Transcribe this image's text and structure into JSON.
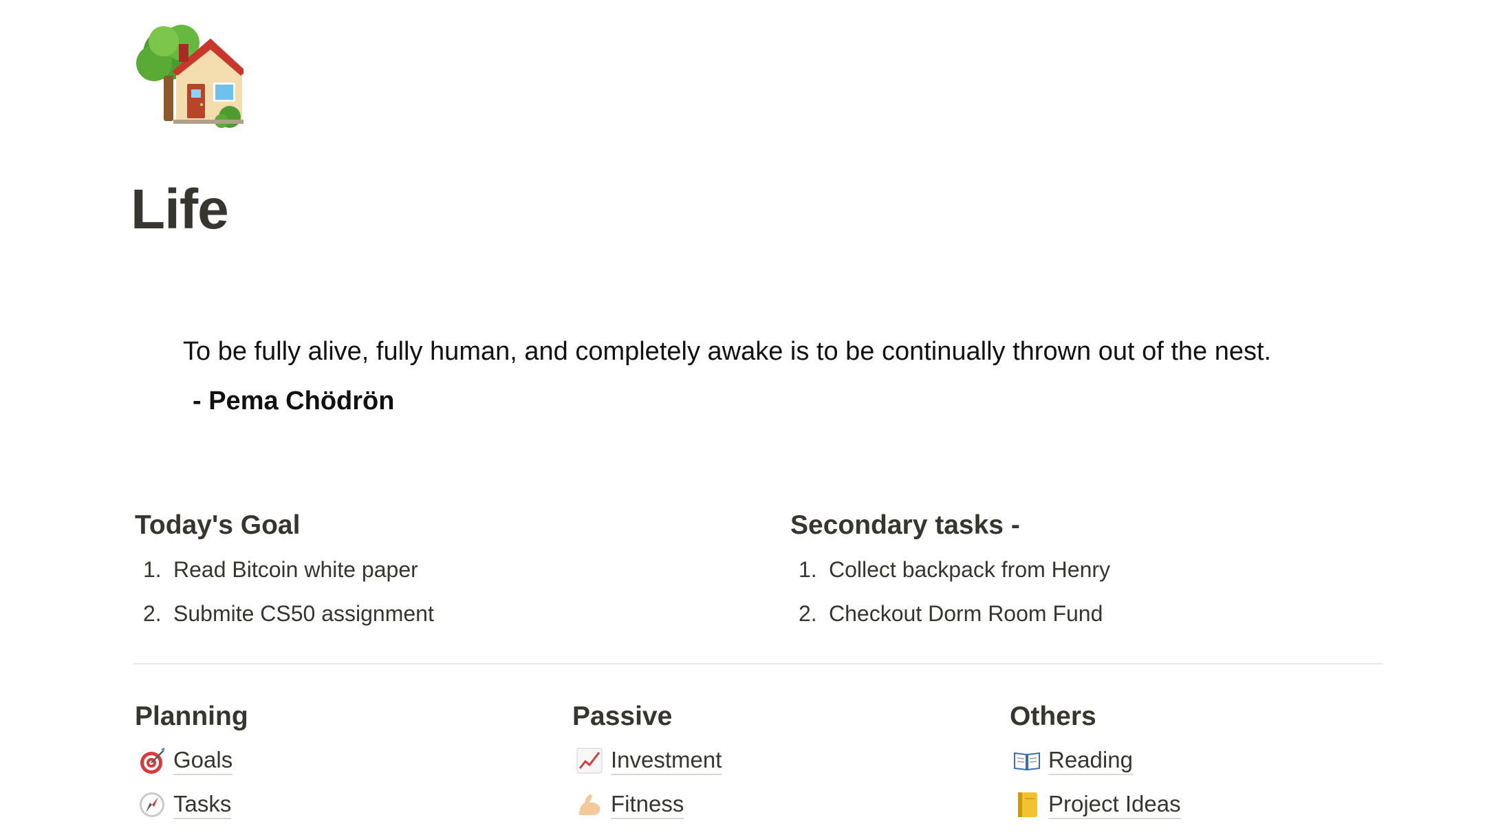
{
  "page": {
    "icon": "house-with-garden-icon",
    "title": "Life"
  },
  "quote": {
    "text": "To be fully alive, fully human, and completely awake is to be continually thrown out of the nest.",
    "author": "- Pema Chödrön"
  },
  "todays_goal": {
    "heading": "Today's Goal",
    "items": [
      {
        "number": "1.",
        "text": "Read Bitcoin white paper"
      },
      {
        "number": "2.",
        "text": "Submite CS50 assignment"
      }
    ]
  },
  "secondary_tasks": {
    "heading": "Secondary tasks -",
    "items": [
      {
        "number": "1.",
        "text": "Collect backpack from Henry"
      },
      {
        "number": "2.",
        "text": "Checkout Dorm Room Fund"
      }
    ]
  },
  "planning": {
    "heading": "Planning",
    "links": [
      {
        "icon": "direct-hit-target-icon",
        "label": "Goals"
      },
      {
        "icon": "compass-icon",
        "label": "Tasks"
      }
    ]
  },
  "passive": {
    "heading": "Passive",
    "links": [
      {
        "icon": "chart-increasing-icon",
        "label": "Investment"
      },
      {
        "icon": "flexed-biceps-icon",
        "label": "Fitness"
      }
    ]
  },
  "others": {
    "heading": "Others",
    "links": [
      {
        "icon": "open-book-icon",
        "label": "Reading"
      },
      {
        "icon": "ledger-notebook-icon",
        "label": "Project Ideas"
      }
    ]
  }
}
